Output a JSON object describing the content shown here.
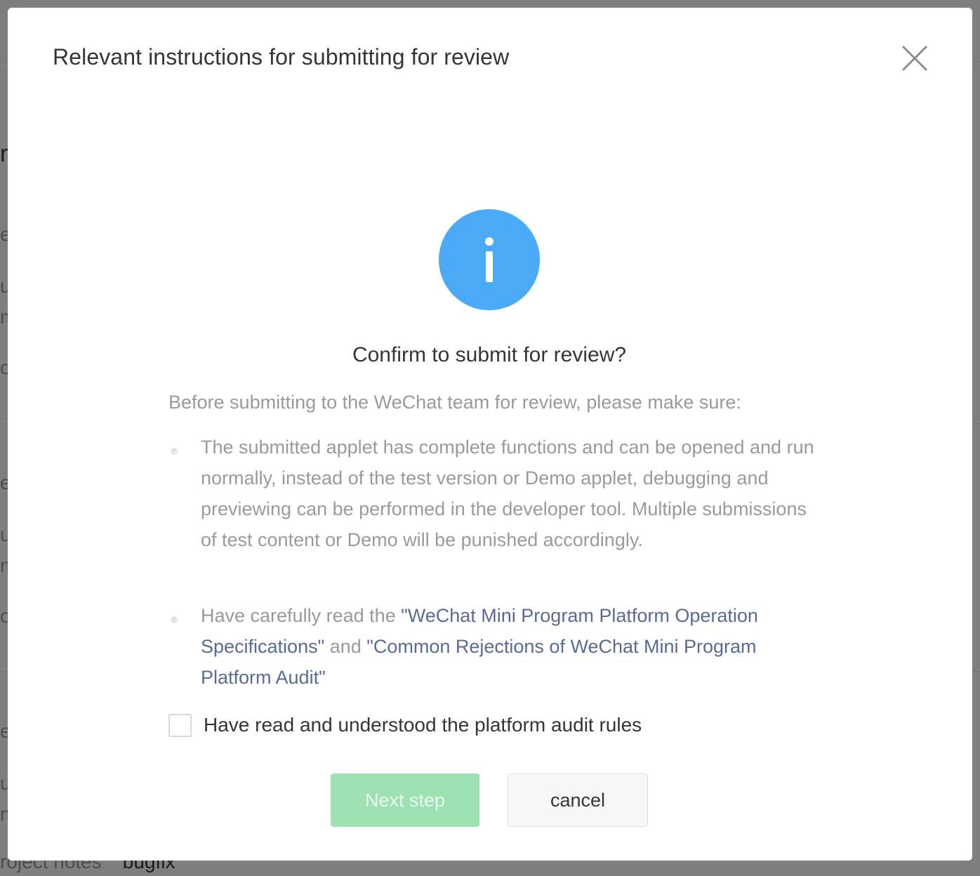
{
  "background": {
    "fragments": [
      "re",
      "e",
      "ul",
      "m",
      "o",
      "e",
      "ul",
      "m",
      "o",
      "e",
      "ul",
      "m"
    ],
    "project_notes_label": "roject notes",
    "project_notes_value": "bugfix"
  },
  "dialog": {
    "title": "Relevant instructions for submitting for review",
    "close_icon": "close-icon",
    "info_icon": "info-icon",
    "confirm_title": "Confirm to submit for review?",
    "intro": "Before submitting to the WeChat team for review, please make sure:",
    "bullet1": "The submitted applet has complete functions and can be opened and run normally, instead of the test version or Demo applet, debugging and previewing can be performed in the developer tool. Multiple submissions of test content or Demo will be punished accordingly.",
    "bullet2": {
      "prefix": "Have carefully read the ",
      "link1": "\"WeChat Mini Program Platform Operation Specifications\"",
      "middle": " and ",
      "link2": "\"Common Rejections of WeChat Mini Program Platform Audit\""
    },
    "agree_label": "Have read and understood the platform audit rules",
    "agree_checked": false,
    "next_label": "Next step",
    "cancel_label": "cancel"
  },
  "colors": {
    "info_blue": "#4aaaf8",
    "link_blue": "#576b95",
    "next_disabled_green": "#9de1b3"
  }
}
